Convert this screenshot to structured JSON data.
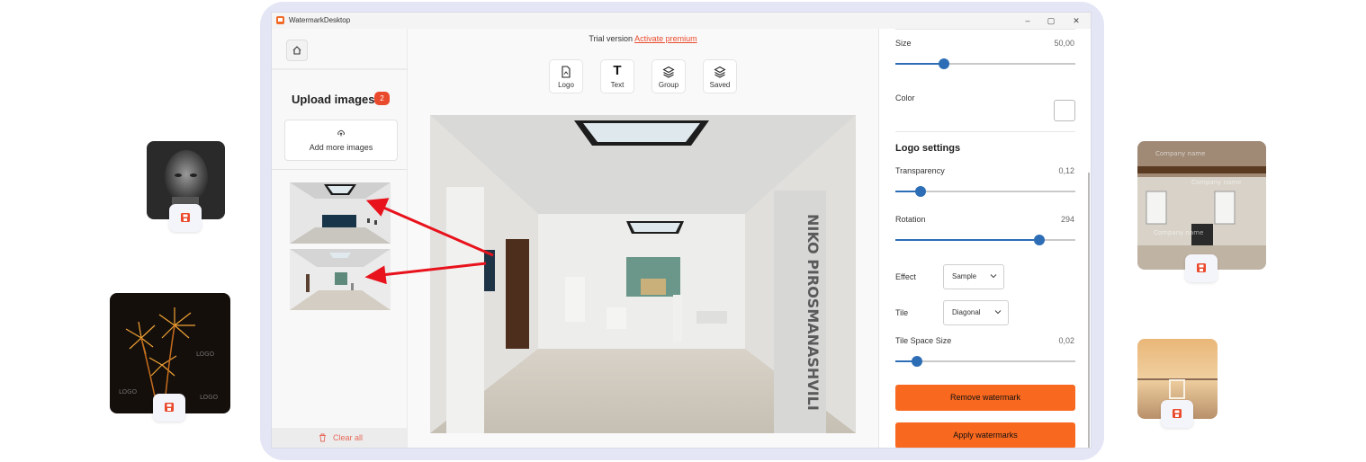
{
  "app": {
    "title": "WatermarkDesktop"
  },
  "window_controls": {
    "minimize": "–",
    "maximize": "▢",
    "close": "✕"
  },
  "sidebar": {
    "upload_title": "Upload images",
    "upload_count": "2",
    "add_more_label": "Add more images",
    "clear_all_label": "Clear all"
  },
  "main": {
    "trial_text": "Trial version",
    "activate_link": "Activate premium",
    "tools": [
      {
        "label": "Logo",
        "icon": "logo-file-icon"
      },
      {
        "label": "Text",
        "icon": "text-T-icon"
      },
      {
        "label": "Group",
        "icon": "layers-icon"
      },
      {
        "label": "Saved",
        "icon": "layers-saved-icon"
      }
    ],
    "preview_watermark_text": "NIKO PIROSMANASHVILI"
  },
  "settings": {
    "size_label": "Size",
    "size_value": "50,00",
    "size_fraction": 0.27,
    "color_label": "Color",
    "color_value": "#ffffff",
    "logo_settings_title": "Logo settings",
    "transparency_label": "Transparency",
    "transparency_value": "0,12",
    "transparency_fraction": 0.14,
    "rotation_label": "Rotation",
    "rotation_value": "294",
    "rotation_fraction": 0.8,
    "effect_label": "Effect",
    "effect_value": "Sample",
    "tile_label": "Tile",
    "tile_value": "Diagonal",
    "tile_space_label": "Tile Space Size",
    "tile_space_value": "0,02",
    "tile_space_fraction": 0.12,
    "remove_button": "Remove watermark",
    "apply_button": "Apply watermarks"
  },
  "side_cards": {
    "logo_watermark_text": "LOGO",
    "company_watermark_text": "Company name"
  },
  "colors": {
    "accent": "#f8681f",
    "badge": "#ea4a2c",
    "slider": "#2c6db5",
    "frame": "#e4e6f6",
    "arrow": "#e8121c"
  }
}
